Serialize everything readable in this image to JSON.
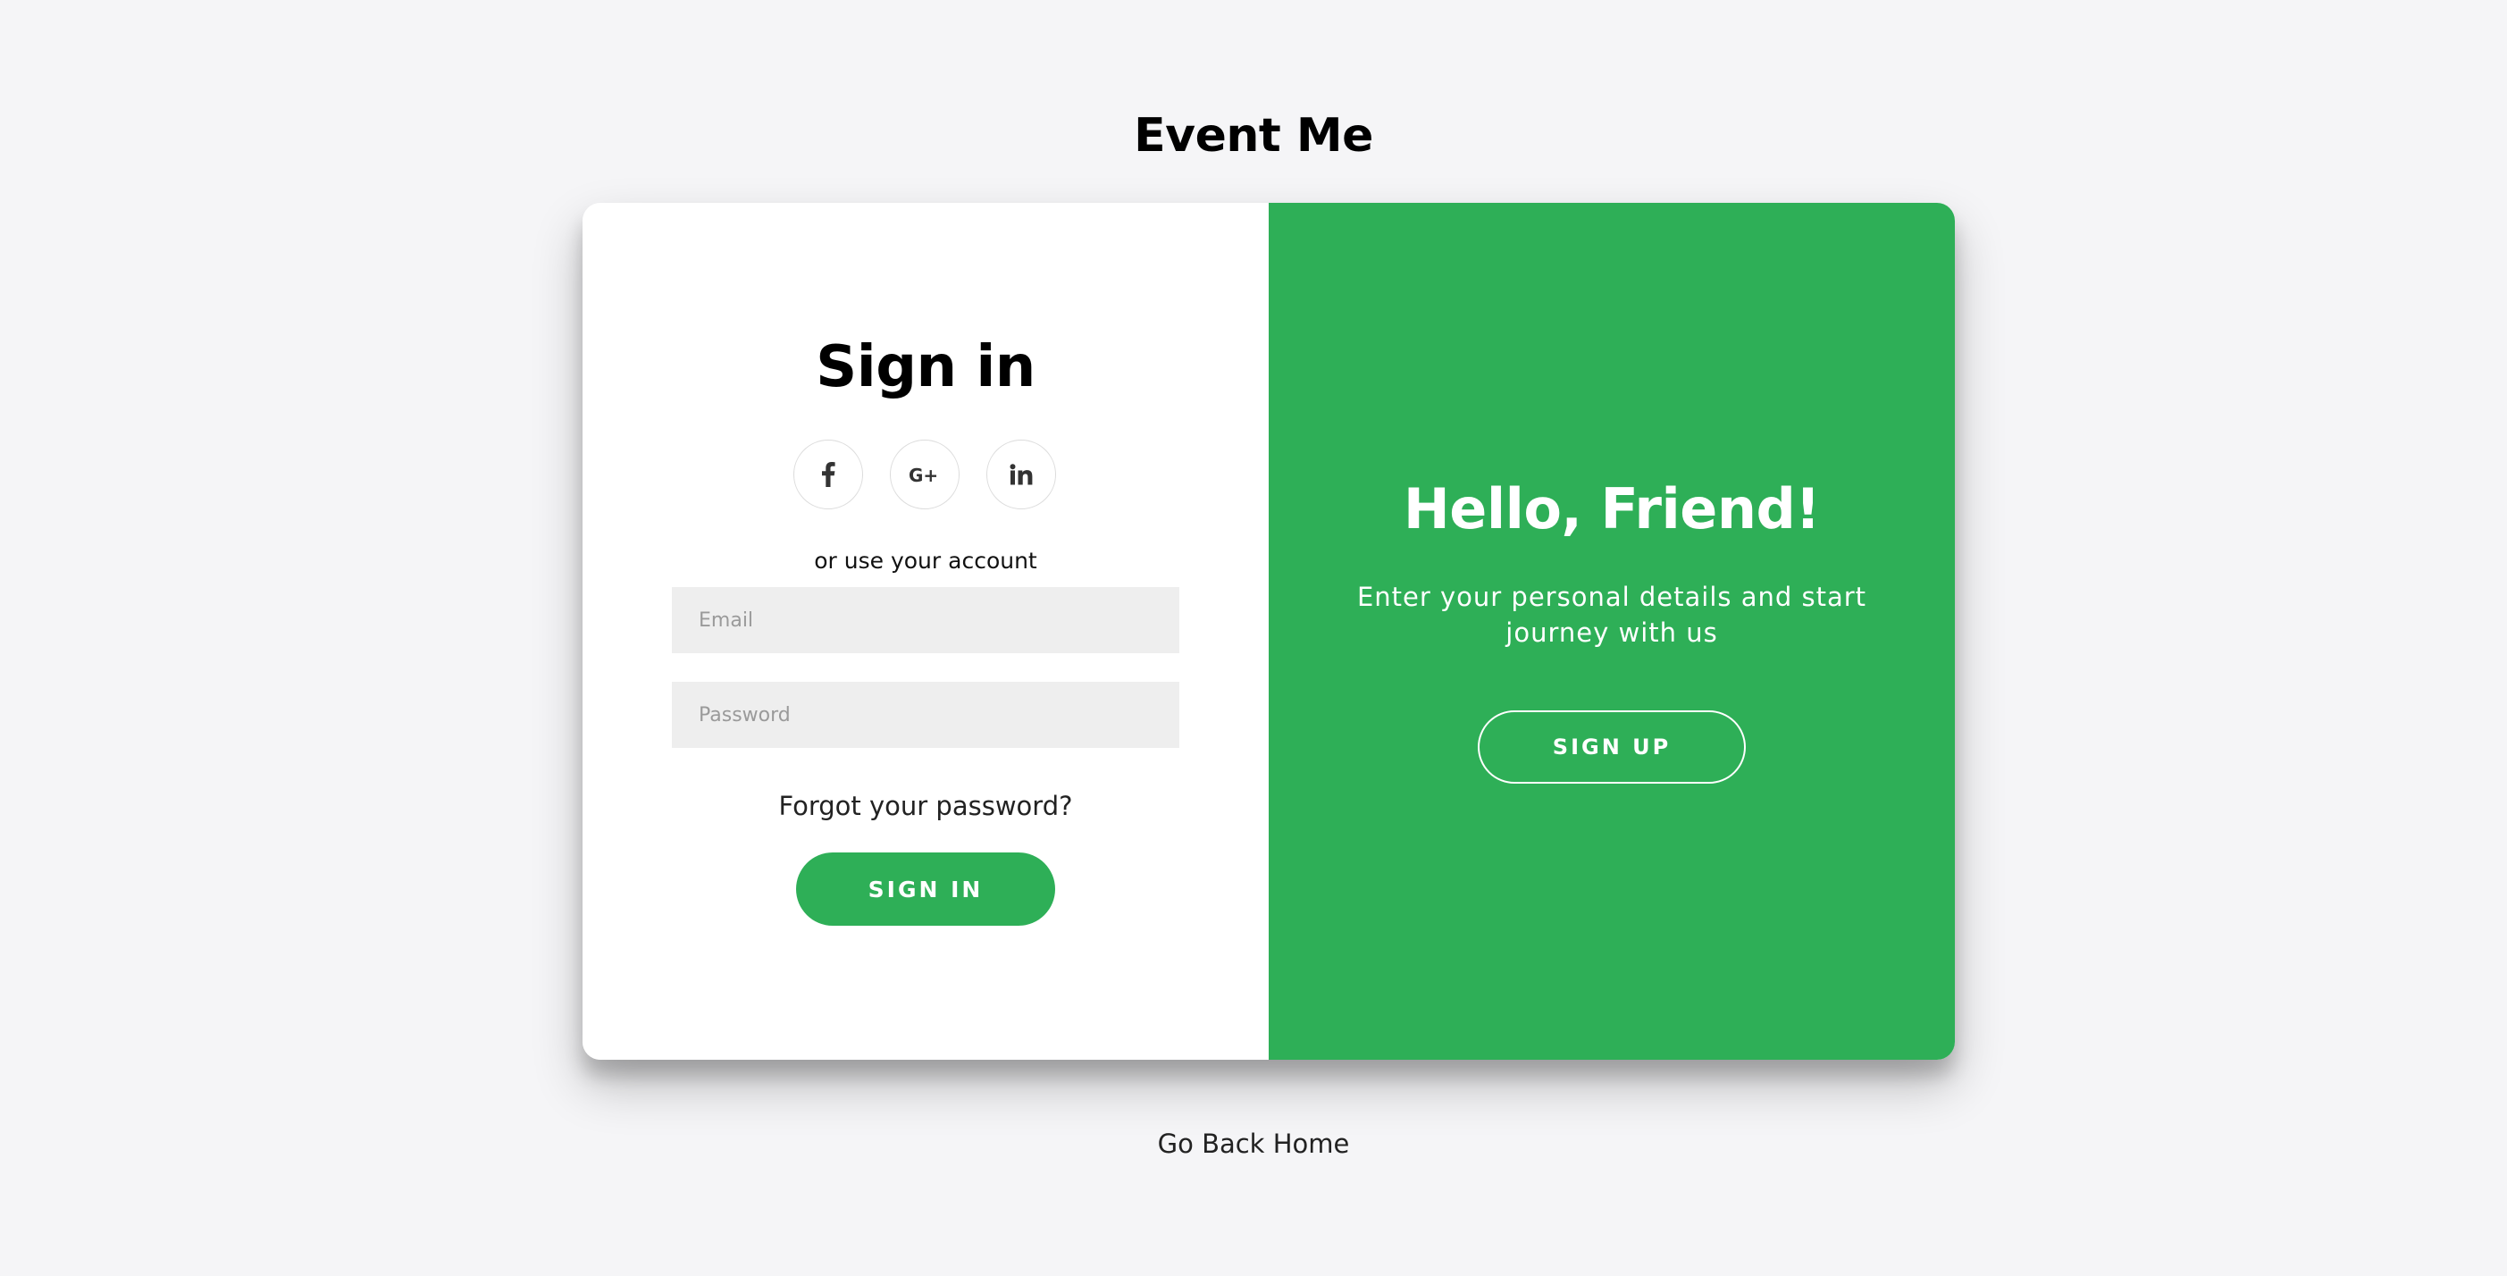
{
  "app": {
    "title": "Event Me"
  },
  "signin": {
    "heading": "Sign in",
    "social": [
      {
        "icon": "facebook-icon",
        "label": "f"
      },
      {
        "icon": "google-plus-icon",
        "label": "G+"
      },
      {
        "icon": "linkedin-icon",
        "label": "in"
      }
    ],
    "alt_text": "or use your account",
    "email_placeholder": "Email",
    "password_placeholder": "Password",
    "forgot_text": "Forgot your password?",
    "button_label": "SIGN IN"
  },
  "signup_panel": {
    "heading": "Hello, Friend!",
    "text": "Enter your personal details and start journey with us",
    "button_label": "SIGN UP"
  },
  "footer": {
    "home_link": "Go Back Home"
  },
  "colors": {
    "accent": "#2eaf57",
    "background": "#f5f5f7",
    "input_bg": "#eeeeee"
  }
}
